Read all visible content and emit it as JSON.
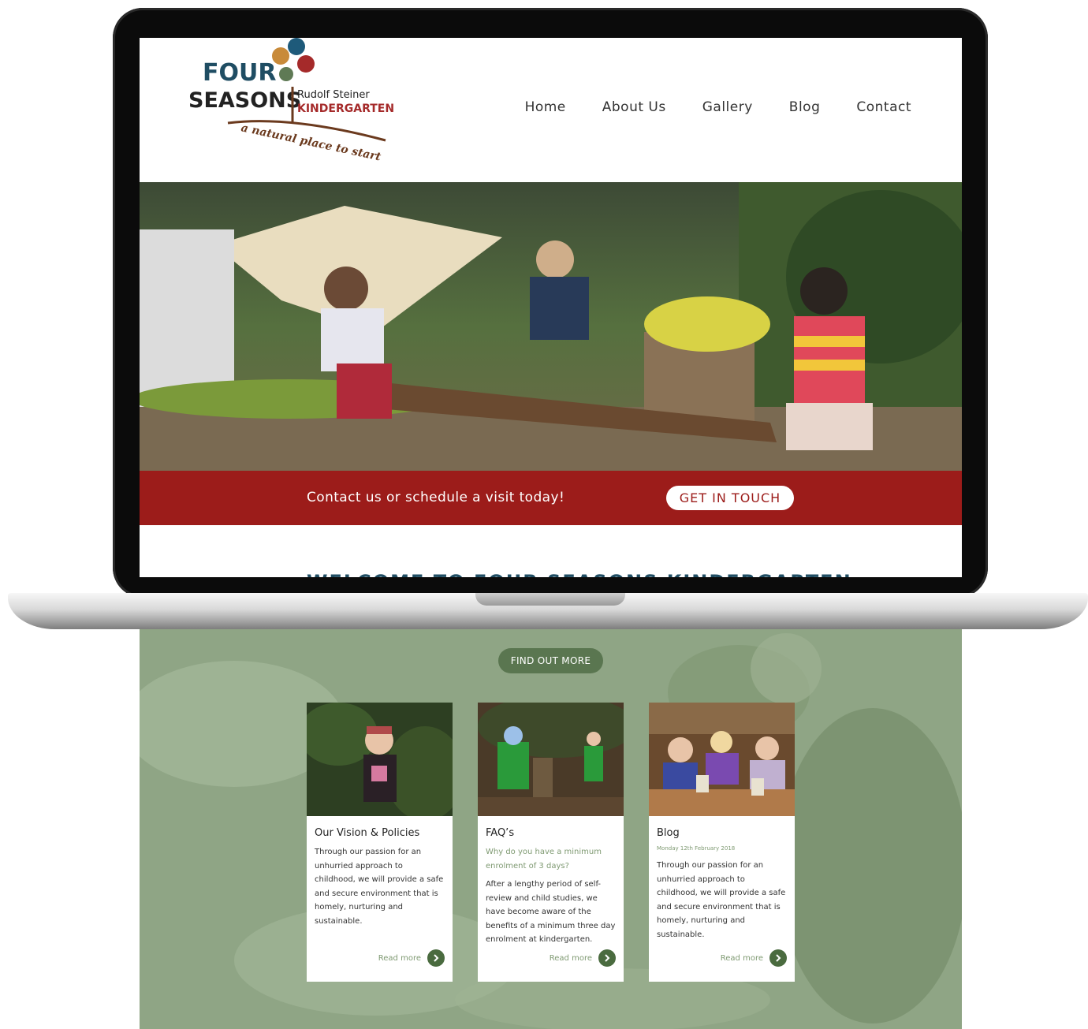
{
  "logo": {
    "line1": "FOUR",
    "line2": "SEASONS",
    "line3": "Rudolf Steiner",
    "line4": "KINDERGARTEN",
    "tagline": "a natural place to start"
  },
  "nav": {
    "items": [
      "Home",
      "About Us",
      "Gallery",
      "Blog",
      "Contact"
    ]
  },
  "cta": {
    "text": "Contact us or schedule a visit today!",
    "button": "GET IN TOUCH"
  },
  "welcome": {
    "heading": "WELCOME TO FOUR SEASONS KINDERGARTEN"
  },
  "section": {
    "button": "FIND OUT MORE"
  },
  "cards": [
    {
      "title": "Our Vision & Policies",
      "text": "Through our passion for an unhurried approach to childhood, we will provide a safe and secure environment that is homely, nurturing and sustainable.",
      "link": "Read more"
    },
    {
      "title": "FAQ’s",
      "subtitle": "Why do you have a minimum enrolment of 3 days?",
      "text": "After a lengthy period of self-review and child studies, we have become aware of the benefits of a minimum three day enrolment at kindergarten.",
      "link": "Read more"
    },
    {
      "title": "Blog",
      "date": "Monday 12th February 2018",
      "text": "Through our passion for an unhurried approach to childhood, we will provide a safe and secure environment that is homely, nurturing and sustainable.",
      "link": "Read more"
    }
  ],
  "colors": {
    "brand_red": "#9c1c1a",
    "brand_green": "#5a7650",
    "section_green": "#8fa585",
    "heading_blue": "#1f4d63"
  },
  "icons": {
    "read_more": "chevron-right-icon"
  }
}
